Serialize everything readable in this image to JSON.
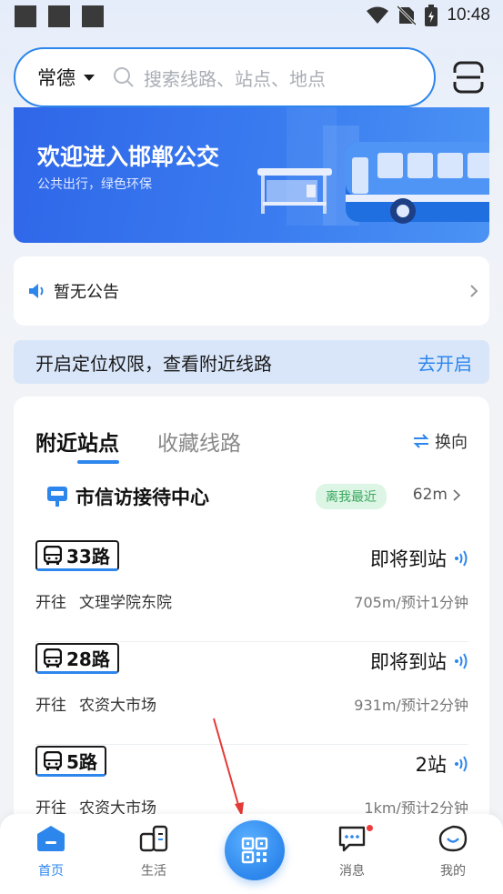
{
  "status_bar": {
    "time": "10:48"
  },
  "header": {
    "city": "常德",
    "search_placeholder": "搜索线路、站点、地点"
  },
  "banner": {
    "title": "欢迎进入邯郸公交",
    "subtitle": "公共出行，绿色环保"
  },
  "notice": {
    "text": "暂无公告"
  },
  "location_prompt": {
    "text": "开启定位权限，查看附近线路",
    "action": "去开启"
  },
  "nearby": {
    "tabs": {
      "nearby_stations": "附近站点",
      "favorite_routes": "收藏线路"
    },
    "switch_label": "换向",
    "station": {
      "name": "市信访接待中心",
      "badge": "离我最近",
      "distance": "62m"
    },
    "routes": [
      {
        "number": "33路",
        "status": "即将到站",
        "direction_label": "开往",
        "destination": "文理学院东院",
        "eta": "705m/预计1分钟"
      },
      {
        "number": "28路",
        "status": "即将到站",
        "direction_label": "开往",
        "destination": "农资大市场",
        "eta": "931m/预计2分钟"
      },
      {
        "number": "5路",
        "status": "2站",
        "direction_label": "开往",
        "destination": "农资大市场",
        "eta": "1km/预计2分钟"
      }
    ]
  },
  "bottom_nav": {
    "items": [
      {
        "label": "首页",
        "icon": "home-icon",
        "active": true
      },
      {
        "label": "生活",
        "icon": "life-icon",
        "active": false
      },
      {
        "label": "",
        "icon": "qr-code-icon",
        "active": false
      },
      {
        "label": "消息",
        "icon": "message-icon",
        "active": false
      },
      {
        "label": "我的",
        "icon": "profile-icon",
        "active": false
      }
    ]
  },
  "colors": {
    "accent": "#2d86ec",
    "banner": "#3a7cf0",
    "badge_bg": "#dcf5e4",
    "badge_text": "#3aa85e",
    "notification_dot": "#ef3b3b"
  }
}
